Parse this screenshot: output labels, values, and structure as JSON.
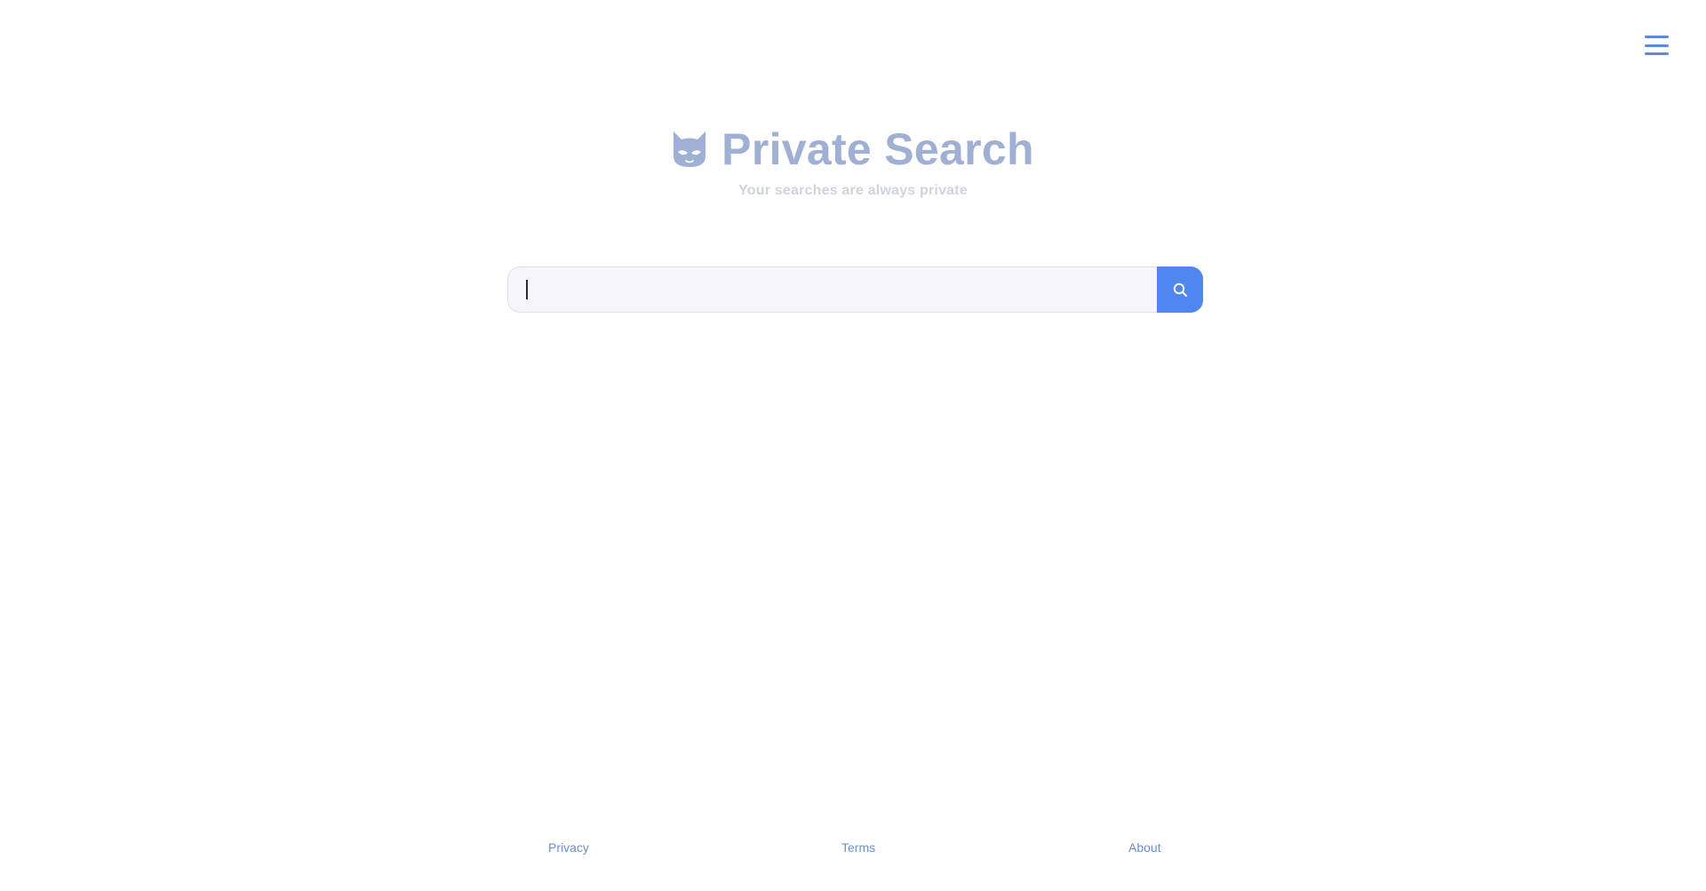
{
  "header": {
    "menu_icon": "hamburger-menu-icon",
    "menu_color": "#5b8ad6"
  },
  "brand": {
    "logo_icon": "masked-cat-icon",
    "title": "Private Search",
    "subtitle": "Your searches are always private",
    "title_color": "#9fb0d4",
    "subtitle_color": "#cfd3da"
  },
  "search": {
    "value": "",
    "placeholder": "",
    "button_icon": "search-icon",
    "accent": "#4f86f0"
  },
  "footer": {
    "links": [
      {
        "label": "Privacy"
      },
      {
        "label": "Terms"
      },
      {
        "label": "About"
      }
    ],
    "link_color": "#6b8fc4"
  }
}
